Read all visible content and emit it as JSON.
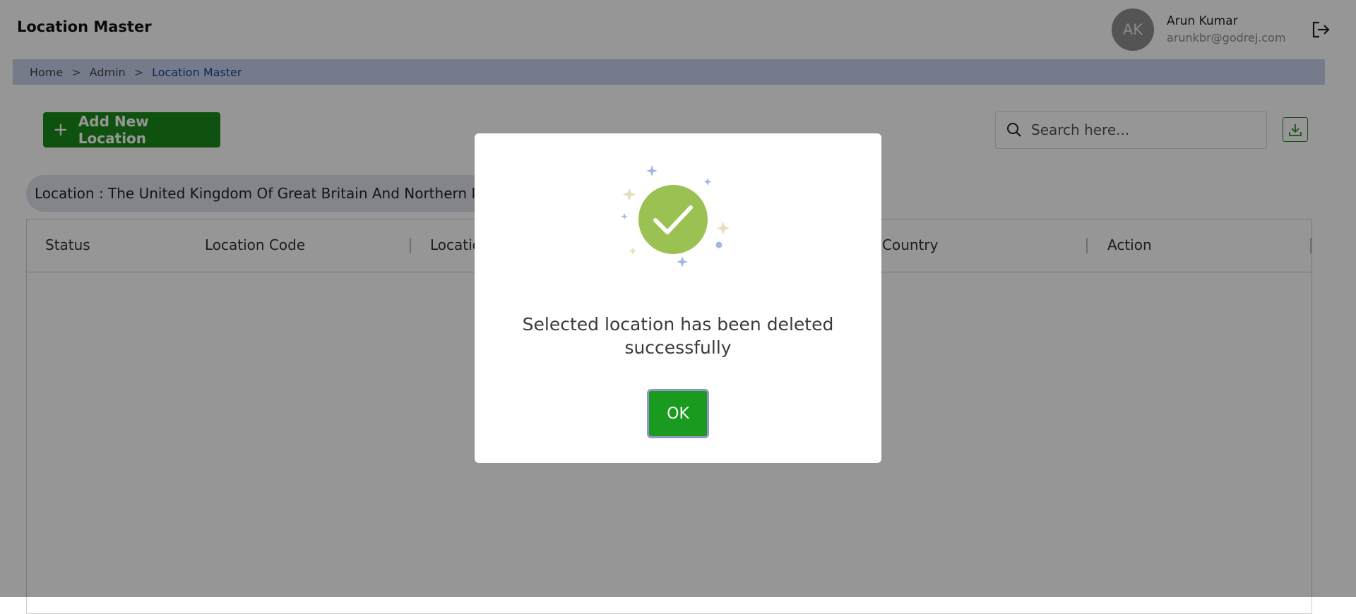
{
  "header": {
    "title": "Location Master",
    "user": {
      "initials": "AK",
      "name": "Arun Kumar",
      "email": "arunkbr@godrej.com"
    }
  },
  "breadcrumb": [
    "Home",
    "Admin",
    "Location Master"
  ],
  "toolbar": {
    "add_label": "Add New Location",
    "search_placeholder": "Search here..."
  },
  "filter_chip": "Location : The United Kingdom Of Great Britain And Northern Ireland",
  "table": {
    "columns": [
      "Status",
      "Location Code",
      "Location",
      "Country",
      "Action"
    ],
    "rows": []
  },
  "modal": {
    "message": "Selected location has been deleted successfully",
    "ok_label": "OK"
  },
  "colors": {
    "primary_green": "#1a8c1a",
    "success_green": "#9bc153",
    "breadcrumb_bg": "#c9d2ee"
  },
  "icons": [
    "logout-icon",
    "plus-icon",
    "search-icon",
    "download-icon",
    "check-circle-icon"
  ]
}
